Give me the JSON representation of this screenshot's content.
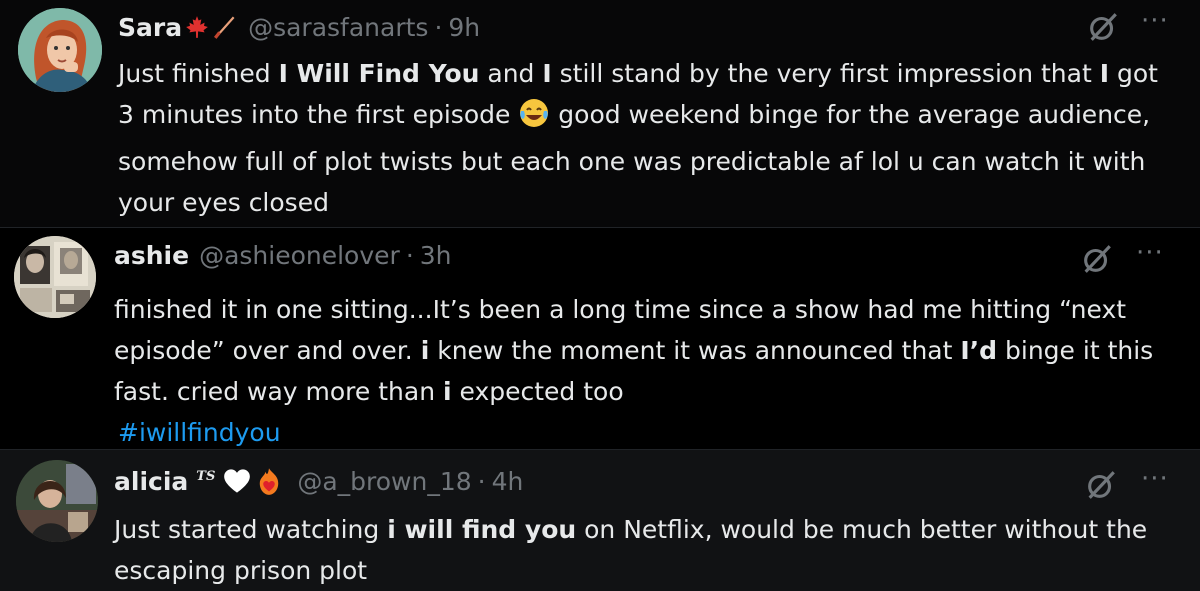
{
  "tweets": [
    {
      "name": "Sara",
      "handle": "@sarasfanarts",
      "separator": "·",
      "time": "9h",
      "badges": [
        "maple-leaf-icon",
        "paintbrush-icon"
      ],
      "text": {
        "p1": "Just finished ",
        "bold1": "I Will Find You",
        "p2": " and ",
        "bold2": "I",
        "p3": " still stand by the very first impression that ",
        "bold3": "I",
        "p4": " got 3 minutes into the first episode ",
        "emoji": "tears-of-joy-emoji",
        "p5": " good weekend binge for the average audience, somehow full of plot twists but each one was predictable af lol u can watch it with your eyes closed"
      },
      "more_label": "···"
    },
    {
      "name": "ashie",
      "handle": "@ashieonelover",
      "separator": "·",
      "time": "3h",
      "text": {
        "p1": "finished it in one sitting...It’s been a long time since a show had me hitting “next episode” over and over. ",
        "bold1": "i",
        "p2": " knew the moment it was announced that ",
        "bold2": "I’d",
        "p3": " binge it this fast. cried way more than ",
        "bold3": "i",
        "p4": " expected too",
        "hashtag": "#iwillfindyou"
      },
      "more_label": "···"
    },
    {
      "name": "alicia",
      "handle": "@a_brown_18",
      "separator": "·",
      "time": "4h",
      "badge_text": "TS",
      "badges": [
        "white-heart-icon",
        "heart-on-fire-icon"
      ],
      "text": {
        "p1": "Just started watching ",
        "bold1": "i will find you",
        "p2": " on Netflix, would be much better without the escaping prison plot"
      },
      "more_label": "···"
    }
  ],
  "colors": {
    "text": "#e7e9ea",
    "secondary": "#71767b",
    "link": "#1d9bf0",
    "background": "#000000"
  }
}
